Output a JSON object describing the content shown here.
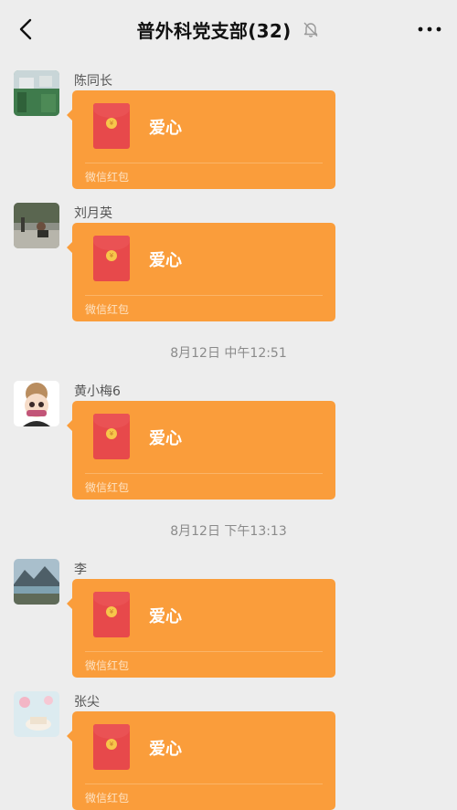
{
  "header": {
    "title": "普外科党支部(32)",
    "back_icon": "chevron-left-icon",
    "mute_icon": "bell-off-icon",
    "more_icon": "more-icon"
  },
  "messages": [
    {
      "sender": "陈同长",
      "packet_title": "爱心",
      "packet_label": "微信红包"
    },
    {
      "sender": "刘月英",
      "packet_title": "爱心",
      "packet_label": "微信红包"
    },
    {
      "sender": "黄小梅6",
      "packet_title": "爱心",
      "packet_label": "微信红包"
    },
    {
      "sender": "李",
      "packet_title": "爱心",
      "packet_label": "微信红包"
    },
    {
      "sender": "张尖",
      "packet_title": "爱心",
      "packet_label": "微信红包"
    }
  ],
  "timestamps": [
    "8月12日 中午12:51",
    "8月12日 下午13:13"
  ],
  "colors": {
    "packet": "#fa9d3b",
    "envelope": "#e7494b",
    "background": "#ededed"
  }
}
